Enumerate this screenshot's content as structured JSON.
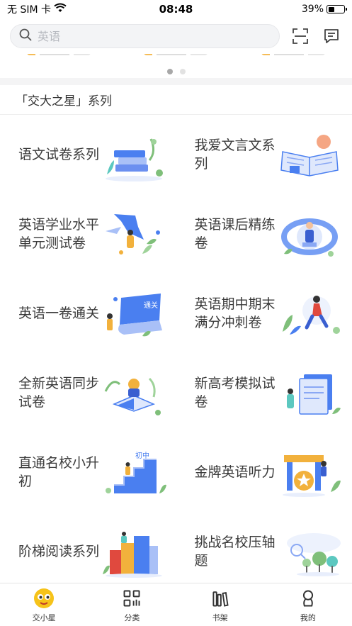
{
  "status_bar": {
    "carrier": "无 SIM 卡",
    "time": "08:48",
    "battery_text": "39%",
    "battery_level": 0.39
  },
  "search": {
    "placeholder": "英语",
    "value": ""
  },
  "icons": {
    "search": "search-icon",
    "scan": "scan-icon",
    "message": "message-icon"
  },
  "carousel": {
    "page_count": 2,
    "active_index": 0
  },
  "section": {
    "title": "「交大之星」系列"
  },
  "series": [
    {
      "title": "语文试卷系列",
      "icon": "books-stack-illustration"
    },
    {
      "title": "我爱文言文系列",
      "icon": "open-book-illustration"
    },
    {
      "title": "英语学业水平单元测试卷",
      "icon": "blue-flag-illustration"
    },
    {
      "title": "英语课后精练卷",
      "icon": "globe-study-illustration"
    },
    {
      "title": "英语一卷通关",
      "icon": "paper-scroll-illustration"
    },
    {
      "title": "英语期中期末满分冲刺卷",
      "icon": "runner-illustration"
    },
    {
      "title": "全新英语同步试卷",
      "icon": "reading-person-illustration"
    },
    {
      "title": "新高考模拟试卷",
      "icon": "exam-board-illustration"
    },
    {
      "title": "直通名校小升初",
      "icon": "stairs-illustration"
    },
    {
      "title": "金牌英语听力",
      "icon": "medal-illustration"
    },
    {
      "title": "阶梯阅读系列",
      "icon": "big-books-illustration"
    },
    {
      "title": "挑战名校压轴题",
      "icon": "trees-illustration"
    }
  ],
  "tabs": [
    {
      "label": "交小星",
      "icon": "mascot-icon",
      "active": true
    },
    {
      "label": "分类",
      "icon": "category-icon",
      "active": false
    },
    {
      "label": "书架",
      "icon": "bookshelf-icon",
      "active": false
    },
    {
      "label": "我的",
      "icon": "profile-icon",
      "active": false
    }
  ],
  "colors": {
    "accent_blue": "#4a7ff0",
    "mascot_yellow": "#f6c31a",
    "text": "#3a3a3a",
    "tab_border": "#e5e5e5"
  }
}
